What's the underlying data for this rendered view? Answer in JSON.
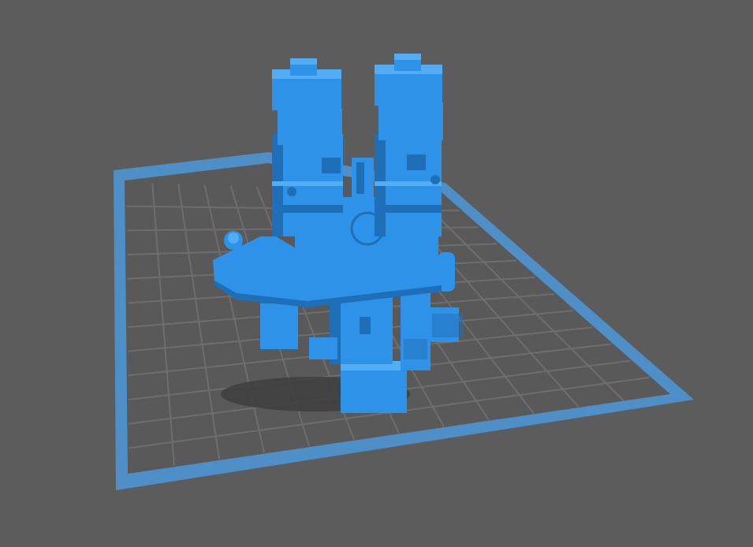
{
  "viewport": {
    "background": "#5c5c5c",
    "bed": {
      "border_color": "#4f8fc8",
      "surface_color": "#595959",
      "grid_color": "#6e6e6e"
    },
    "model": {
      "color": "#2e93e8",
      "shade_color": "#1f6fb8",
      "highlight_color": "#52adf5",
      "shadow_color": "#3e3e3e"
    }
  }
}
